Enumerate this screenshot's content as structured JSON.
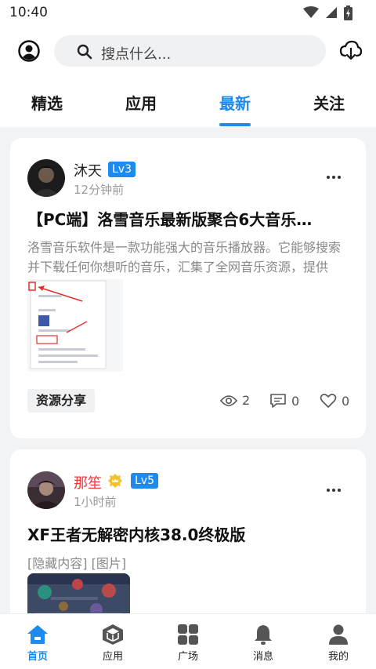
{
  "status_bar": {
    "time": "10:40"
  },
  "search": {
    "placeholder": "搜点什么..."
  },
  "tabs": [
    {
      "label": "精选"
    },
    {
      "label": "应用"
    },
    {
      "label": "最新",
      "active": true
    },
    {
      "label": "关注"
    }
  ],
  "posts": [
    {
      "author": "沐天",
      "level": "Lv3",
      "time_ago": "12分钟前",
      "title": "【PC端】洛雪音乐最新版聚合6大音乐…",
      "excerpt": "洛雪音乐软件是一款功能强大的音乐播放器。它能够搜索并下载任何你想听的音乐，汇集了全网音乐资源，提供",
      "tag": "资源分享",
      "views": "2",
      "comments": "0",
      "likes": "0"
    },
    {
      "author": "那笙",
      "level": "Lv5",
      "time_ago": "1小时前",
      "title": "XF王者无解密内核38.0终极版",
      "hidden_note": "[隐藏内容] [图片]"
    }
  ],
  "bottom_nav": [
    {
      "label": "首页",
      "icon": "home-icon",
      "active": true
    },
    {
      "label": "应用",
      "icon": "cube-icon"
    },
    {
      "label": "广场",
      "icon": "grid-icon"
    },
    {
      "label": "消息",
      "icon": "bell-icon"
    },
    {
      "label": "我的",
      "icon": "person-icon"
    }
  ],
  "colors": {
    "accent": "#1d8af0",
    "author_highlight": "#ee3a3a",
    "background": "#f2f3f5"
  }
}
